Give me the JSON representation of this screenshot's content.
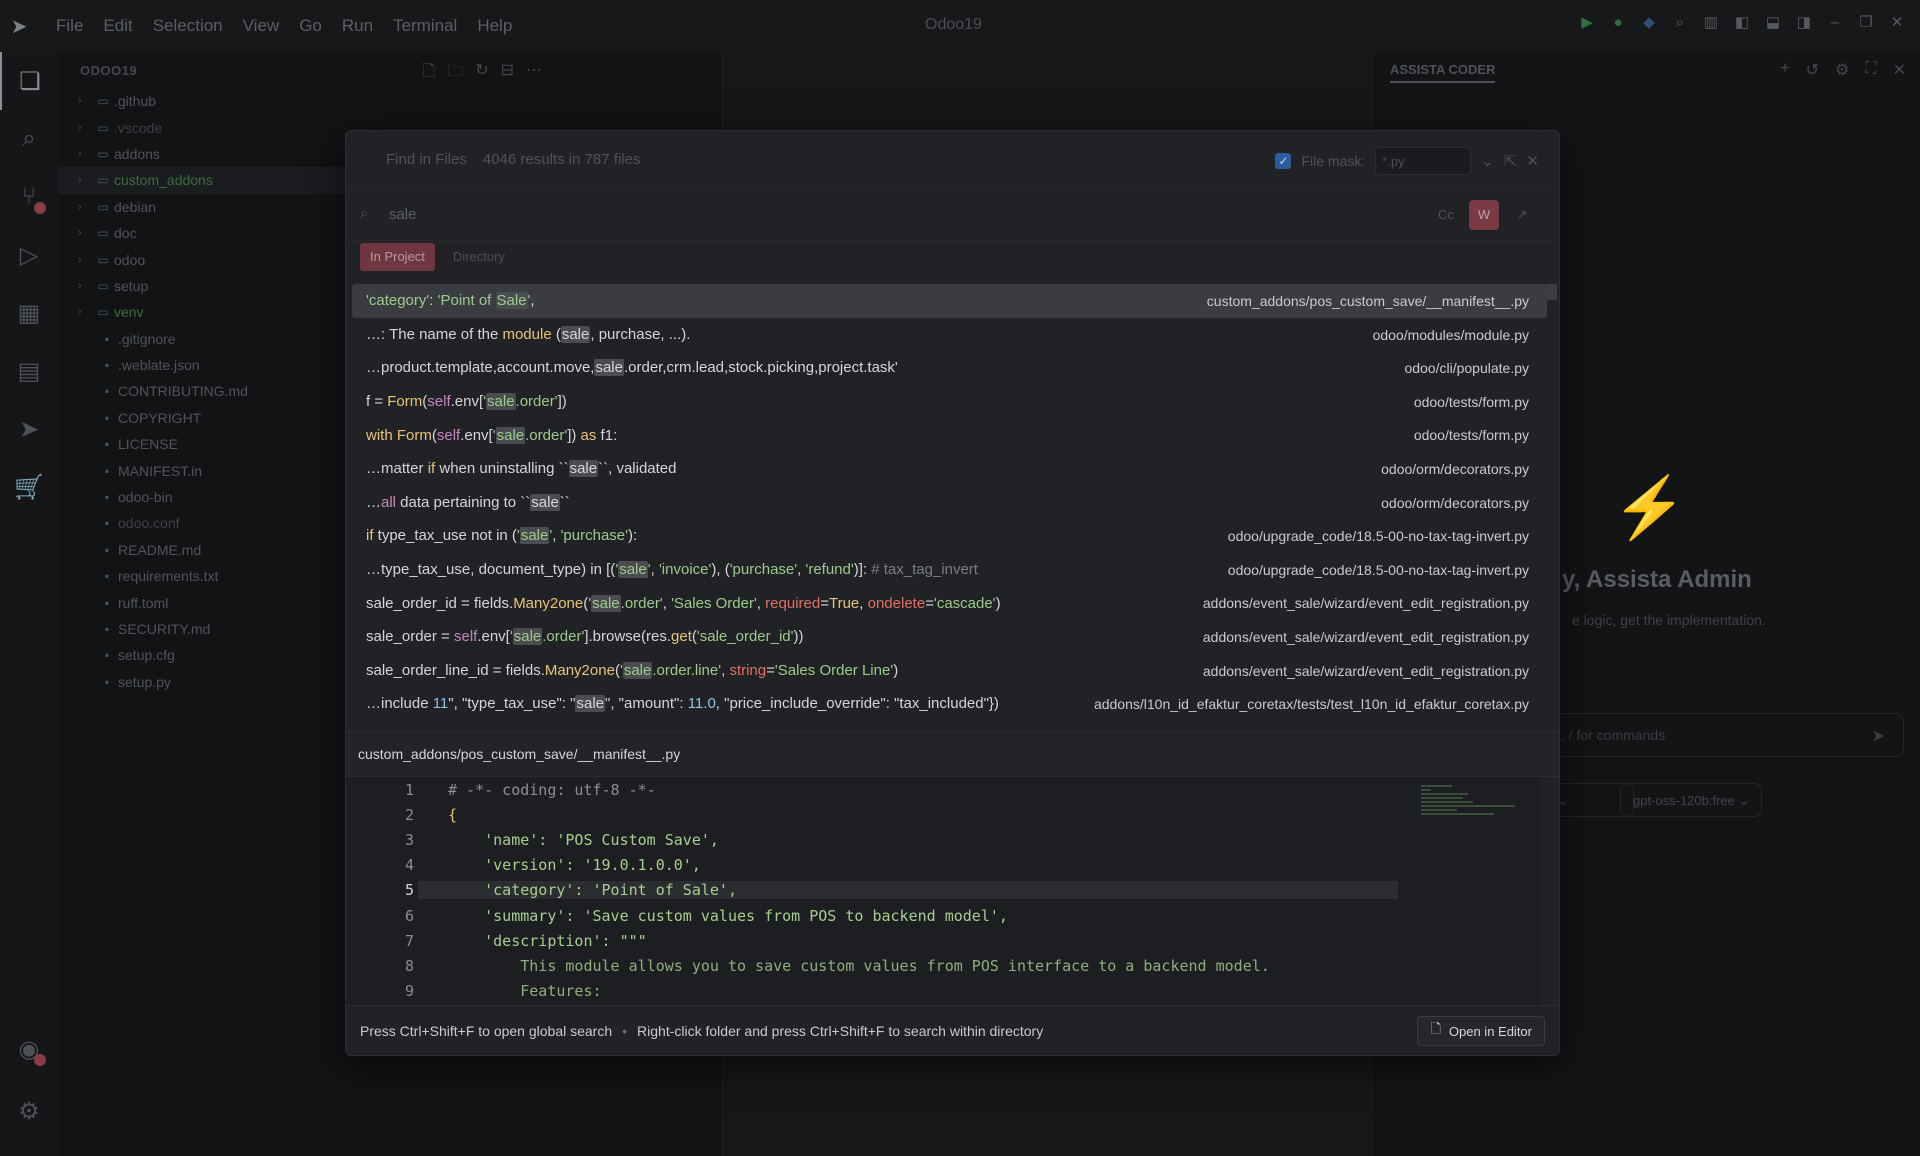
{
  "window": {
    "title": "Odoo19"
  },
  "menu": [
    "File",
    "Edit",
    "Selection",
    "View",
    "Go",
    "Run",
    "Terminal",
    "Help"
  ],
  "explorer": {
    "title": "ODOO19",
    "items": [
      {
        "label": ".github",
        "type": "folder"
      },
      {
        "label": ".vscode",
        "type": "folder",
        "dim": true
      },
      {
        "label": "addons",
        "type": "folder"
      },
      {
        "label": "custom_addons",
        "type": "folder",
        "green": true,
        "selected": true
      },
      {
        "label": "debian",
        "type": "folder"
      },
      {
        "label": "doc",
        "type": "folder"
      },
      {
        "label": "odoo",
        "type": "folder"
      },
      {
        "label": "setup",
        "type": "folder"
      },
      {
        "label": "venv",
        "type": "folder",
        "green": true
      },
      {
        "label": ".gitignore",
        "type": "file"
      },
      {
        "label": ".weblate.json",
        "type": "file"
      },
      {
        "label": "CONTRIBUTING.md",
        "type": "file"
      },
      {
        "label": "COPYRIGHT",
        "type": "file"
      },
      {
        "label": "LICENSE",
        "type": "file"
      },
      {
        "label": "MANIFEST.in",
        "type": "file"
      },
      {
        "label": "odoo-bin",
        "type": "file"
      },
      {
        "label": "odoo.conf",
        "type": "file",
        "dim": true
      },
      {
        "label": "README.md",
        "type": "file"
      },
      {
        "label": "requirements.txt",
        "type": "file"
      },
      {
        "label": "ruff.toml",
        "type": "file"
      },
      {
        "label": "SECURITY.md",
        "type": "file"
      },
      {
        "label": "setup.cfg",
        "type": "file"
      },
      {
        "label": "setup.py",
        "type": "file"
      }
    ]
  },
  "assistant": {
    "tab": "ASSISTA CODER",
    "greeting": "y, Assista Admin",
    "subtitle": "e logic, get the implementation.",
    "input_placeholder": "t, / for commands",
    "model": "gpt-oss-120b:free"
  },
  "find": {
    "title": "Find in Files",
    "count": "4046 results in 787 files",
    "file_mask_label": "File mask:",
    "file_mask_value": "*.py",
    "query": "sale",
    "option_case": "Cc",
    "option_word": "W",
    "scope_project": "In Project",
    "scope_directory": "Directory",
    "results": [
      {
        "file": "custom_addons/pos_custom_save/__manifest__.py"
      },
      {
        "file": "odoo/modules/module.py"
      },
      {
        "file": "odoo/cli/populate.py"
      },
      {
        "file": "odoo/tests/form.py"
      },
      {
        "file": "odoo/tests/form.py"
      },
      {
        "file": "odoo/orm/decorators.py"
      },
      {
        "file": "odoo/orm/decorators.py"
      },
      {
        "file": "odoo/upgrade_code/18.5-00-no-tax-tag-invert.py"
      },
      {
        "file": "odoo/upgrade_code/18.5-00-no-tax-tag-invert.py"
      },
      {
        "file": "addons/event_sale/wizard/event_edit_registration.py"
      },
      {
        "file": "addons/event_sale/wizard/event_edit_registration.py"
      },
      {
        "file": "addons/event_sale/wizard/event_edit_registration.py"
      },
      {
        "file": "addons/l10n_id_efaktur_coretax/tests/test_l10n_id_efaktur_coretax.py"
      }
    ],
    "preview_file": "custom_addons/pos_custom_save/__manifest__.py",
    "footer_hint_1": "Press Ctrl+Shift+F to open global search",
    "footer_sep": "•",
    "footer_hint_2": "Right-click folder and press Ctrl+Shift+F to search within directory",
    "open_button": "Open in Editor"
  },
  "code": {
    "lines": [
      {
        "n": "1",
        "text": "# -*- coding: utf-8 -*-"
      },
      {
        "n": "2",
        "text": "{"
      },
      {
        "n": "3",
        "text": "    'name': 'POS Custom Save',"
      },
      {
        "n": "4",
        "text": "    'version': '19.0.1.0.0',"
      },
      {
        "n": "5",
        "text": "    'category': 'Point of Sale',"
      },
      {
        "n": "6",
        "text": "    'summary': 'Save custom values from POS to backend model',"
      },
      {
        "n": "7",
        "text": "    'description': \"\"\""
      },
      {
        "n": "8",
        "text": "        This module allows you to save custom values from POS interface to a backend model."
      },
      {
        "n": "9",
        "text": "        Features:"
      }
    ],
    "current_line": "5"
  },
  "colors": {
    "accent": "#7a3a44",
    "string": "#a7cf8f",
    "keyword": "#c586c0",
    "function": "#e8c474"
  }
}
